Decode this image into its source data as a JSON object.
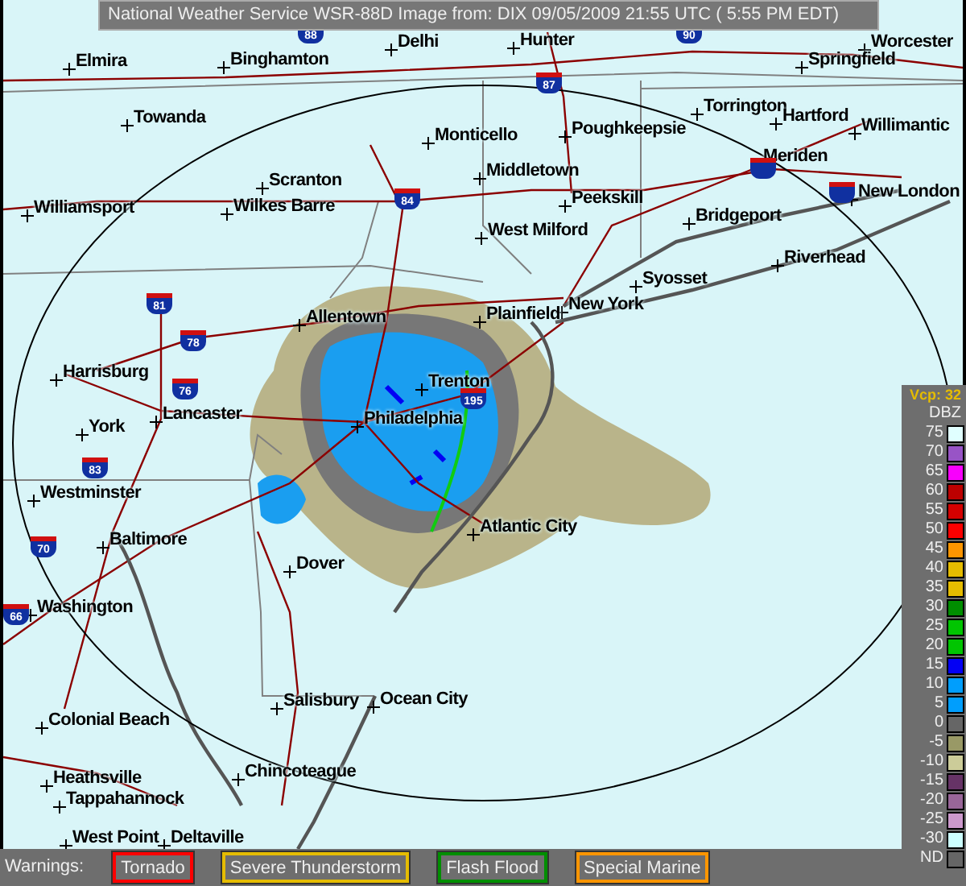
{
  "header": {
    "text": "National Weather Service WSR-88D Image from: DIX 09/05/2009 21:55 UTC ( 5:55 PM EDT)"
  },
  "map": {
    "cities": [
      "Delhi",
      "Elmira",
      "Binghamton",
      "Hunter",
      "Worcester",
      "Springfield",
      "Towanda",
      "Monticello",
      "Torrington",
      "Hartford",
      "Poughkeepsie",
      "Willimantic",
      "Meriden",
      "Middletown",
      "Scranton",
      "Wilkes Barre",
      "Peekskill",
      "New London",
      "Williamsport",
      "Bridgeport",
      "West Milford",
      "Riverhead",
      "Syosset",
      "New York",
      "Plainfield",
      "Allentown",
      "Trenton",
      "Harrisburg",
      "York",
      "Lancaster",
      "Philadelphia",
      "Westminster",
      "Baltimore",
      "Atlantic City",
      "Dover",
      "Washington",
      "Salisbury",
      "Ocean City",
      "Colonial Beach",
      "Chincoteague",
      "Heathsville",
      "Tappahannock",
      "West Point",
      "Deltaville"
    ],
    "interstates": [
      "88",
      "87",
      "90",
      "84",
      "81",
      "78",
      "76",
      "83",
      "70",
      "66",
      "195"
    ]
  },
  "legend": {
    "vcp": "Vcp: 32",
    "unit": "DBZ",
    "levels": [
      {
        "label": "75",
        "color": "#e0ffff"
      },
      {
        "label": "70",
        "color": "#9854c6"
      },
      {
        "label": "65",
        "color": "#f800fd"
      },
      {
        "label": "60",
        "color": "#bc0000"
      },
      {
        "label": "55",
        "color": "#d40000"
      },
      {
        "label": "50",
        "color": "#fd0000"
      },
      {
        "label": "45",
        "color": "#fd9500"
      },
      {
        "label": "40",
        "color": "#e5bc00"
      },
      {
        "label": "35",
        "color": "#e5bc00"
      },
      {
        "label": "30",
        "color": "#008e00"
      },
      {
        "label": "25",
        "color": "#01c501"
      },
      {
        "label": "20",
        "color": "#01c501"
      },
      {
        "label": "15",
        "color": "#0300f4"
      },
      {
        "label": "10",
        "color": "#009efd"
      },
      {
        "label": "5",
        "color": "#009efd"
      },
      {
        "label": "0",
        "color": "#666666"
      },
      {
        "label": "-5",
        "color": "#999966"
      },
      {
        "label": "-10",
        "color": "#cccc99"
      },
      {
        "label": "-15",
        "color": "#663366"
      },
      {
        "label": "-20",
        "color": "#996699"
      },
      {
        "label": "-25",
        "color": "#cc99cc"
      },
      {
        "label": "-30",
        "color": "#ccffff"
      },
      {
        "label": "ND",
        "color": "#666666"
      }
    ]
  },
  "warnings": {
    "label": "Warnings:",
    "buttons": [
      {
        "label": "Tornado",
        "color": "#ff0000"
      },
      {
        "label": "Severe Thunderstorm",
        "color": "#e5bc00"
      },
      {
        "label": "Flash Flood",
        "color": "#008e00"
      },
      {
        "label": "Special Marine",
        "color": "#fd9500"
      }
    ]
  }
}
